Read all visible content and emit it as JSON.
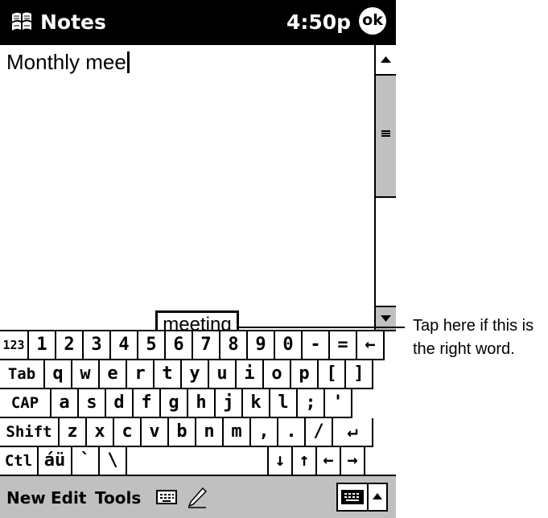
{
  "titlebar": {
    "app_title": "Notes",
    "time": "4:50p",
    "ok_label": "ok",
    "start_icon": "windows-flag-icon"
  },
  "note": {
    "text": "Monthly mee"
  },
  "suggestion": {
    "prefix": "meet",
    "underlined": "ing"
  },
  "callout": {
    "line1": "Tap here if this is",
    "line2": "the right word."
  },
  "keyboard": {
    "rows": [
      [
        "123",
        "1",
        "2",
        "3",
        "4",
        "5",
        "6",
        "7",
        "8",
        "9",
        "0",
        "-",
        "=",
        "←"
      ],
      [
        "Tab",
        "q",
        "w",
        "e",
        "r",
        "t",
        "y",
        "u",
        "i",
        "o",
        "p",
        "[",
        "]"
      ],
      [
        "CAP",
        "a",
        "s",
        "d",
        "f",
        "g",
        "h",
        "j",
        "k",
        "l",
        ";",
        "'"
      ],
      [
        "Shift",
        "z",
        "x",
        "c",
        "v",
        "b",
        "n",
        "m",
        ",",
        ".",
        "/",
        "↵"
      ],
      [
        "Ctl",
        "áü",
        "`",
        "\\",
        "",
        "↓",
        "↑",
        "←",
        "→"
      ]
    ]
  },
  "command_bar": {
    "menu_new": "New",
    "menu_edit": "Edit",
    "menu_tools": "Tools"
  },
  "icons": {
    "keyboard_icon": "keyboard-icon",
    "pen_icon": "pen-icon",
    "input_panel_icon": "input-panel-icon"
  }
}
